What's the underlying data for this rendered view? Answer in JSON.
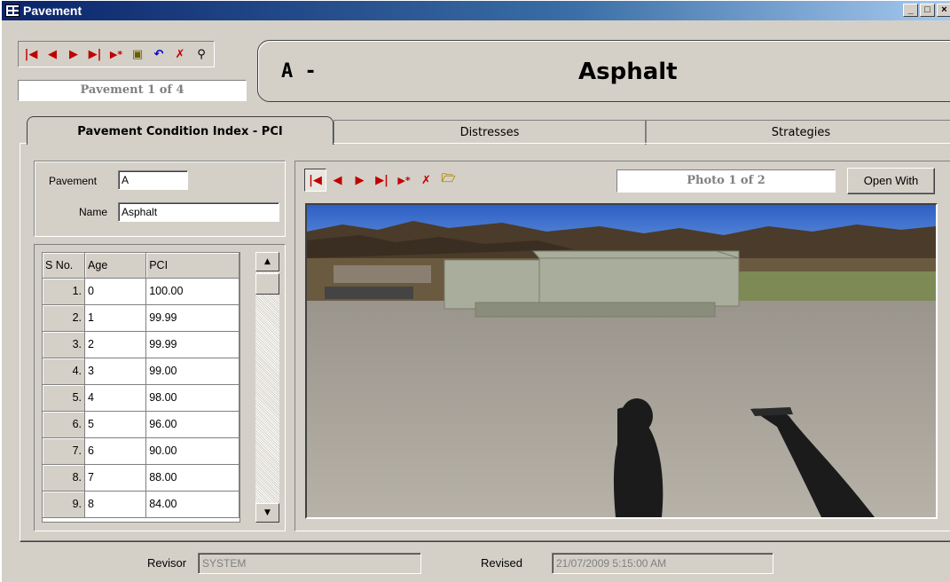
{
  "window": {
    "title": "Pavement"
  },
  "toolbar": {
    "buttons": [
      "first-record",
      "previous-record",
      "next-record",
      "last-record",
      "new-record",
      "save-record",
      "undo",
      "delete-record",
      "find"
    ]
  },
  "record_counter": "Pavement 1 of 4",
  "header": {
    "code": "A -",
    "name": "Asphalt"
  },
  "tabs": [
    {
      "label": "Pavement Condition Index - PCI",
      "active": true
    },
    {
      "label": "Distresses",
      "active": false
    },
    {
      "label": "Strategies",
      "active": false
    }
  ],
  "pavement_fields": {
    "pavement_label": "Pavement",
    "pavement_value": "A",
    "name_label": "Name",
    "name_value": "Asphalt"
  },
  "pci_table": {
    "headers": [
      "S No.",
      "Age",
      "PCI"
    ],
    "rows": [
      [
        "1.",
        "0",
        "100.00"
      ],
      [
        "2.",
        "1",
        "99.99"
      ],
      [
        "3.",
        "2",
        "99.99"
      ],
      [
        "4.",
        "3",
        "99.00"
      ],
      [
        "5.",
        "4",
        "98.00"
      ],
      [
        "6.",
        "5",
        "96.00"
      ],
      [
        "7.",
        "6",
        "90.00"
      ],
      [
        "8.",
        "7",
        "88.00"
      ],
      [
        "9.",
        "8",
        "84.00"
      ]
    ]
  },
  "photo": {
    "counter": "Photo 1 of 2",
    "open_with_label": "Open With"
  },
  "footer": {
    "revisor_label": "Revisor",
    "revisor_value": "SYSTEM",
    "revised_label": "Revised",
    "revised_value": "21/07/2009 5:15:00 AM"
  },
  "colors": {
    "title_bar": "#0a246a",
    "face": "#d4d0c8",
    "nav_red": "#c00000"
  }
}
